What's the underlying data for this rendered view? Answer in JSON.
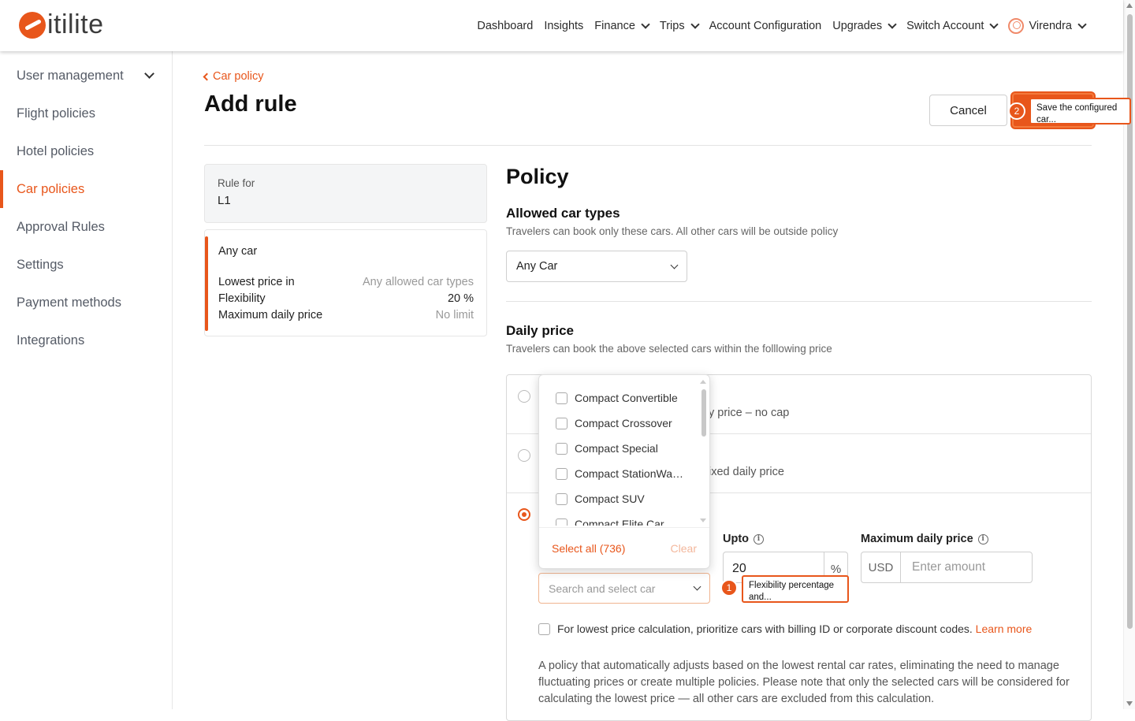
{
  "brand": {
    "logo_text": "itilite",
    "accent": "#e8561b"
  },
  "nav": {
    "items": [
      {
        "label": "Dashboard",
        "has_menu": false
      },
      {
        "label": "Insights",
        "has_menu": false
      },
      {
        "label": "Finance",
        "has_menu": true
      },
      {
        "label": "Trips",
        "has_menu": true
      },
      {
        "label": "Account Configuration",
        "has_menu": false
      },
      {
        "label": "Upgrades",
        "has_menu": true
      },
      {
        "label": "Switch Account",
        "has_menu": true
      }
    ],
    "user_name": "Virendra"
  },
  "sidebar": {
    "items": [
      {
        "label": "User management",
        "active": false
      },
      {
        "label": "Flight policies",
        "active": false
      },
      {
        "label": "Hotel policies",
        "active": false
      },
      {
        "label": "Car policies",
        "active": true
      },
      {
        "label": "Approval Rules",
        "active": false
      },
      {
        "label": "Settings",
        "active": false
      },
      {
        "label": "Payment methods",
        "active": false
      },
      {
        "label": "Integrations",
        "active": false
      }
    ]
  },
  "header": {
    "back_label": "Car policy",
    "title": "Add rule",
    "cancel_label": "Cancel"
  },
  "summary": {
    "rule_for_label": "Rule for",
    "rule_for_value": "L1",
    "title": "Any car",
    "rows": [
      {
        "key": "Lowest price in",
        "value": "Any allowed car types"
      },
      {
        "key": "Flexibility",
        "value": "20 %"
      },
      {
        "key": "Maximum daily price",
        "value": "No limit"
      }
    ]
  },
  "policy": {
    "title": "Policy",
    "car_types": {
      "title": "Allowed car types",
      "description": "Travelers can book only these cars. All other cars will be outside policy",
      "selected": "Any Car"
    },
    "daily_price": {
      "title": "Daily price",
      "description": "Travelers can book the above selected cars within the folllowing price",
      "option1_text": "y price – no cap",
      "option2_text": "ixed daily price",
      "upto_label": "Upto",
      "upto_value": "20",
      "upto_unit": "%",
      "max_label": "Maximum daily price",
      "currency": "USD",
      "amount_placeholder": "Enter amount",
      "search_placeholder": "Search and select car",
      "checkbox_text": "For lowest price calculation, prioritize cars with billing ID or corporate discount codes.",
      "learn_more": "Learn more",
      "paragraph": "A policy that automatically adjusts based on the lowest rental car rates, eliminating the need to manage fluctuating prices or create multiple policies. Please note that only the selected cars will be considered for calculating the lowest price — all other cars are excluded from this calculation."
    }
  },
  "dropdown": {
    "items": [
      "Compact Convertible",
      "Compact Crossover",
      "Compact Special",
      "Compact StationWa…",
      "Compact SUV",
      "Compact Elite Car"
    ],
    "select_all": "Select all (736)",
    "clear": "Clear"
  },
  "annotations": [
    {
      "number": "1",
      "text": "Flexibility percentage and..."
    },
    {
      "number": "2",
      "text": "Save the configured car..."
    }
  ]
}
